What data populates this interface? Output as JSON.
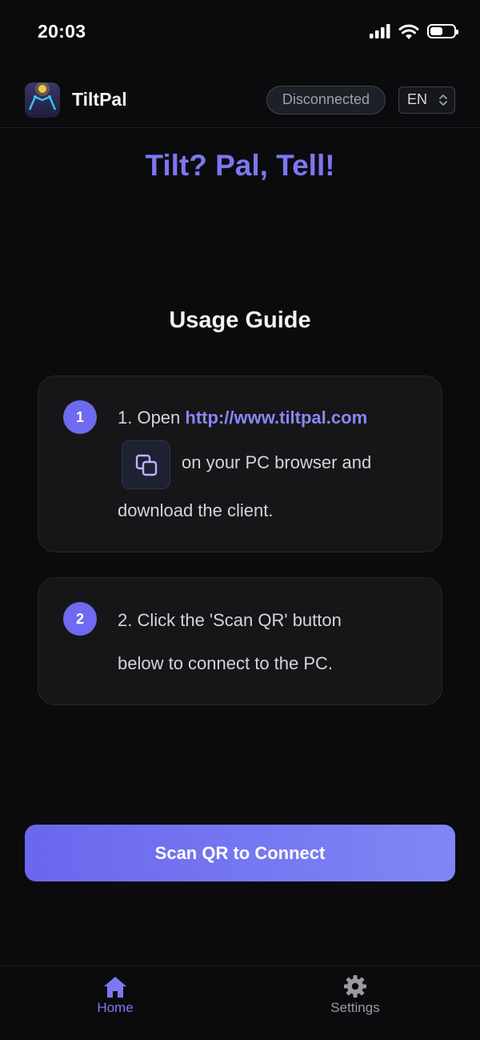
{
  "status_bar": {
    "time": "20:03"
  },
  "header": {
    "app_name": "TiltPal",
    "connection_status": "Disconnected",
    "language": "EN"
  },
  "tagline": "Tilt? Pal, Tell!",
  "guide": {
    "title": "Usage Guide",
    "steps": [
      {
        "number": "1",
        "prefix": "1. Open",
        "link": "http://www.tiltpal.com",
        "middle": "on your PC browser and",
        "suffix": "download the client."
      },
      {
        "number": "2",
        "line1": "2. Click the 'Scan QR' button",
        "line2": "below to connect to the PC."
      }
    ]
  },
  "scan_button": {
    "label": "Scan QR to Connect"
  },
  "tabs": [
    {
      "label": "Home",
      "icon": "home-icon",
      "active": true
    },
    {
      "label": "Settings",
      "icon": "gear-icon",
      "active": false
    }
  ],
  "colors": {
    "accent": "#7d77f2",
    "background": "#0b0b0d",
    "card": "#161619"
  }
}
